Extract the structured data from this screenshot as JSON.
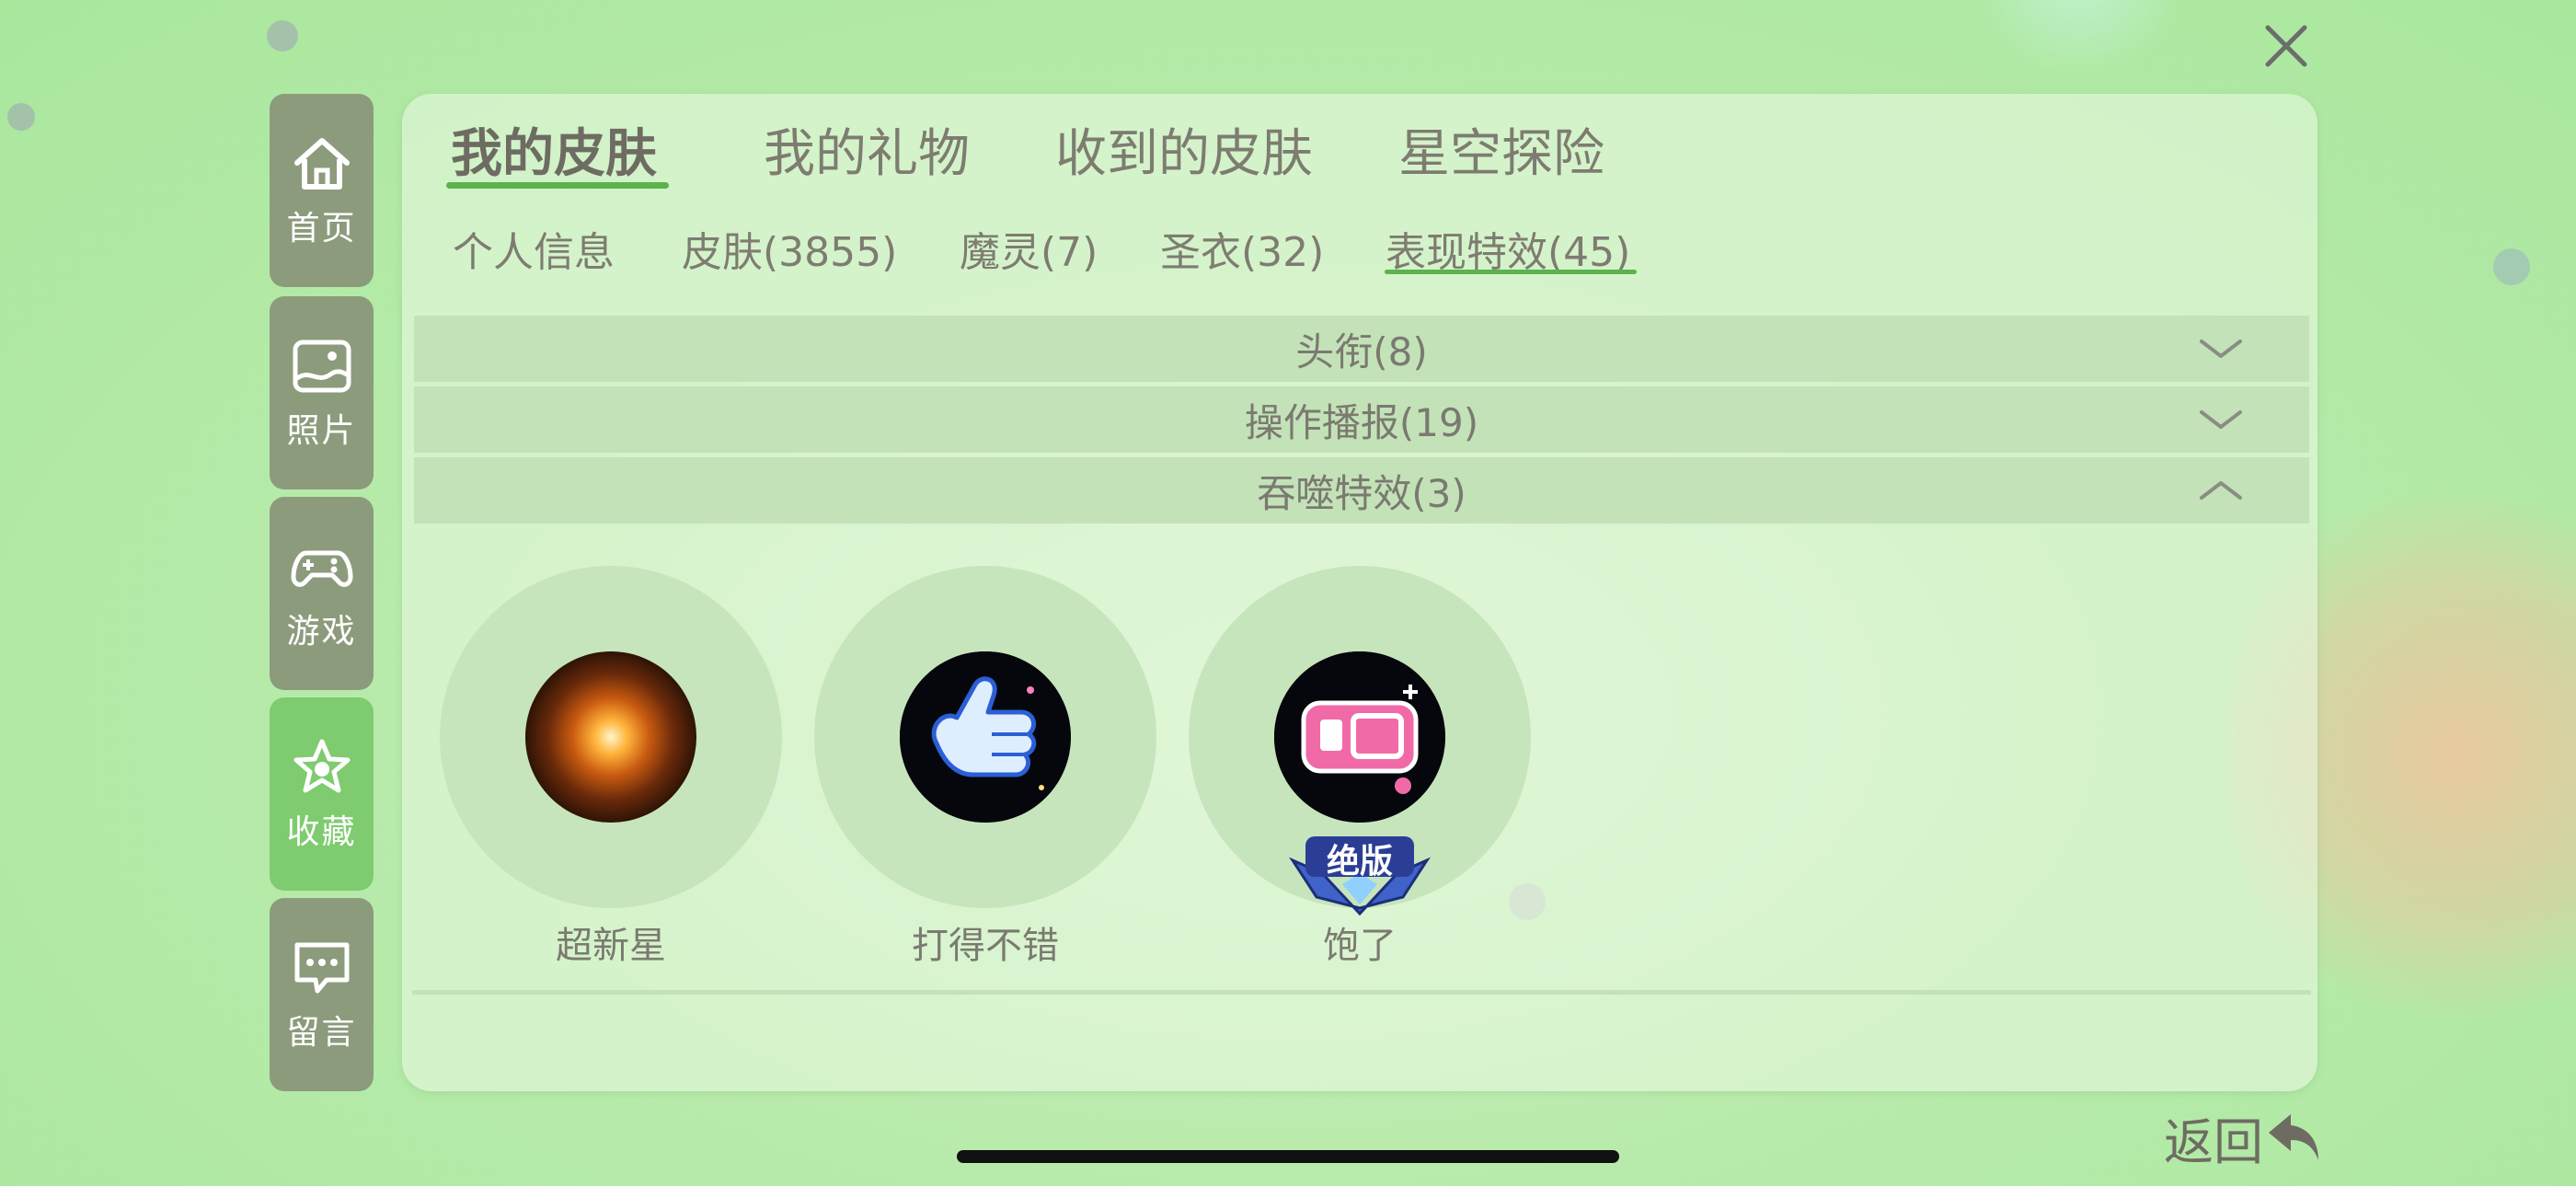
{
  "main_tabs": [
    {
      "label": "我的皮肤",
      "active": true
    },
    {
      "label": "我的礼物",
      "active": false
    },
    {
      "label": "收到的皮肤",
      "active": false
    },
    {
      "label": "星空探险",
      "active": false
    }
  ],
  "sub_tabs": [
    {
      "label": "个人信息",
      "active": false
    },
    {
      "label": "皮肤(3855)",
      "active": false
    },
    {
      "label": "魔灵(7)",
      "active": false
    },
    {
      "label": "圣衣(32)",
      "active": false
    },
    {
      "label": "表现特效(45)",
      "active": true
    }
  ],
  "sidebar": [
    {
      "label": "首页",
      "icon": "home-icon",
      "active": false
    },
    {
      "label": "照片",
      "icon": "photo-icon",
      "active": false
    },
    {
      "label": "游戏",
      "icon": "gamepad-icon",
      "active": false
    },
    {
      "label": "收藏",
      "icon": "star-icon",
      "active": true
    },
    {
      "label": "留言",
      "icon": "message-icon",
      "active": false
    }
  ],
  "sections": [
    {
      "title": "头衔(8)",
      "expanded": false
    },
    {
      "title": "操作播报(19)",
      "expanded": false
    },
    {
      "title": "吞噬特效(3)",
      "expanded": true
    }
  ],
  "items": [
    {
      "label": "超新星",
      "icon": "supernova-icon"
    },
    {
      "label": "打得不错",
      "icon": "thumbs-up-icon"
    },
    {
      "label": "饱了",
      "icon": "burp-icon",
      "badge": "绝版"
    }
  ],
  "back_label": "返回",
  "colors": {
    "accent": "#5bb34d",
    "sidebar": "#8c9b7c",
    "sidebar_active": "#7fcb70",
    "text": "#7a7a70"
  }
}
